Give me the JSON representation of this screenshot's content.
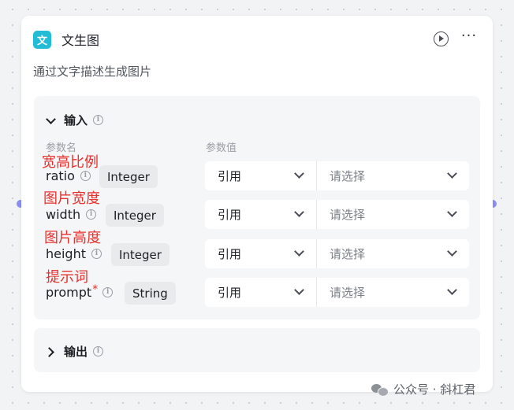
{
  "node": {
    "icon_glyph": "文",
    "title": "文生图",
    "description": "通过文字描述生成图片",
    "accent_color": "#22bcd6"
  },
  "input_section": {
    "title": "输入",
    "col_name_header": "参数名",
    "col_value_header": "参数值",
    "params": [
      {
        "annotation": "宽高比例",
        "name": "ratio",
        "required_mark": "",
        "type": "Integer",
        "ref_label": "引用",
        "value_placeholder": "请选择"
      },
      {
        "annotation": "图片宽度",
        "name": "width",
        "required_mark": "",
        "type": "Integer",
        "ref_label": "引用",
        "value_placeholder": "请选择"
      },
      {
        "annotation": "图片高度",
        "name": "height",
        "required_mark": "",
        "type": "Integer",
        "ref_label": "引用",
        "value_placeholder": "请选择"
      },
      {
        "annotation": "提示词",
        "name": "prompt",
        "required_mark": "*",
        "type": "String",
        "ref_label": "引用",
        "value_placeholder": "请选择"
      }
    ]
  },
  "output_section": {
    "title": "输出"
  },
  "icons": {
    "run": "play-circle-icon",
    "more": "more-horizontal-icon",
    "info": "info-circle-icon",
    "info_glyph": "i",
    "more_glyph": "···",
    "watermark": "wechat-icon"
  },
  "watermark": {
    "text": "公众号 · 斜杠君"
  }
}
